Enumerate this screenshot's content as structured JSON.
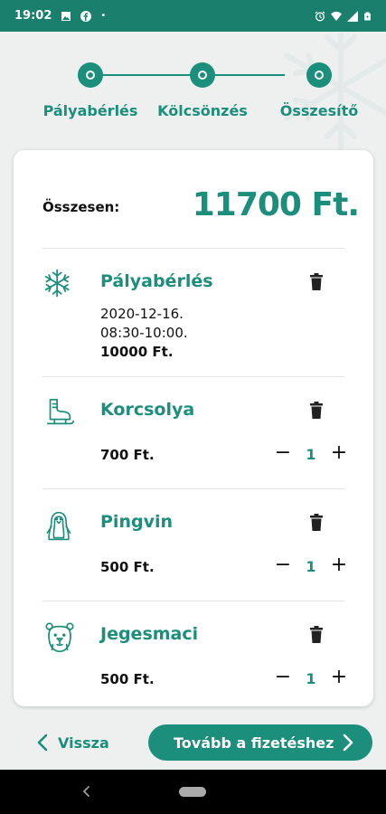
{
  "status": {
    "time": "19:02",
    "dot": "•",
    "icons": [
      "image-icon",
      "facebook-icon",
      "alarm-icon",
      "wifi-icon",
      "signal-icon",
      "battery-icon"
    ]
  },
  "stepper": {
    "steps": [
      {
        "label": "Pályabérlés"
      },
      {
        "label": "Kölcsönzés"
      },
      {
        "label": "Összesítő"
      }
    ]
  },
  "summary": {
    "total_label": "Összesen:",
    "total_value": "11700 Ft."
  },
  "items": [
    {
      "icon": "snowflake-icon",
      "title": "Pályabérlés",
      "lines": [
        "2020-12-16.",
        "08:30-10:00."
      ],
      "price": "10000 Ft."
    },
    {
      "icon": "skate-icon",
      "title": "Korcsolya",
      "price": "700 Ft.",
      "qty": "1"
    },
    {
      "icon": "penguin-icon",
      "title": "Pingvin",
      "price": "500 Ft.",
      "qty": "1"
    },
    {
      "icon": "bear-icon",
      "title": "Jegesmaci",
      "price": "500 Ft.",
      "qty": "1"
    }
  ],
  "qty_controls": {
    "minus": "−",
    "plus": "+"
  },
  "footer": {
    "back_label": "Vissza",
    "next_label": "Tovább a fizetéshez"
  },
  "colors": {
    "accent": "#1b8f7b",
    "status_bar": "#1b7f6e",
    "background": "#eef0f0"
  }
}
